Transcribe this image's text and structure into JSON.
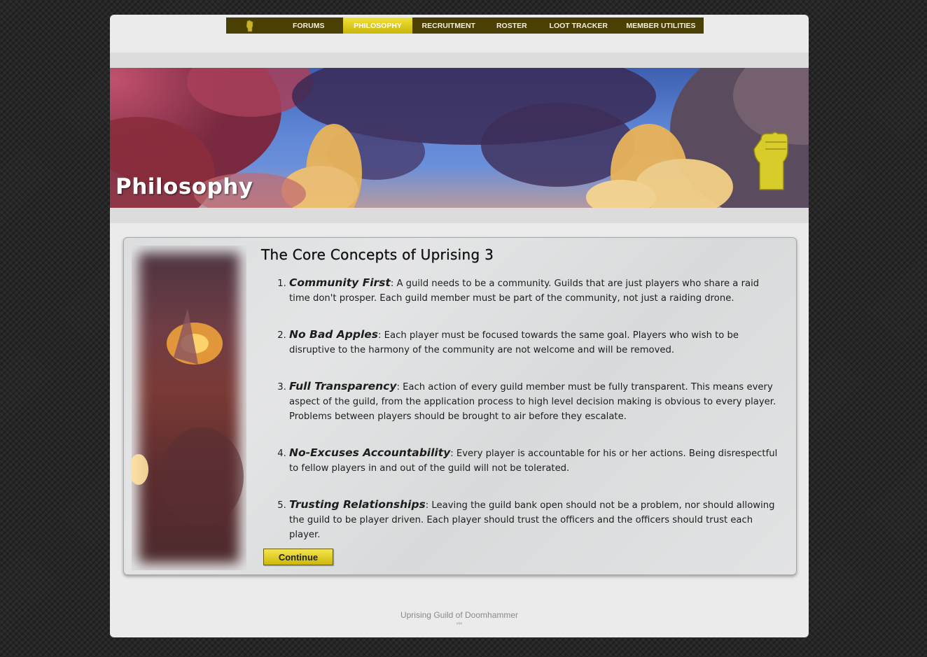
{
  "nav": {
    "logo_icon": "fist-icon",
    "items": [
      {
        "label": "FORUMS",
        "active": false
      },
      {
        "label": "PHILOSOPHY",
        "active": true
      },
      {
        "label": "RECRUITMENT",
        "active": false
      },
      {
        "label": "ROSTER",
        "active": false
      },
      {
        "label": "LOOT TRACKER",
        "active": false
      },
      {
        "label": "MEMBER UTILITIES",
        "active": false
      }
    ]
  },
  "hero": {
    "title": "Philosophy",
    "emblem_icon": "fist-emblem-icon"
  },
  "main": {
    "heading": "The Core Concepts of Uprising 3",
    "concepts": [
      {
        "term": "Community First",
        "text": ": A guild needs to be a community. Guilds that are just players who share a raid time don't prosper. Each guild member must be part of the community, not just a raiding drone."
      },
      {
        "term": "No Bad Apples",
        "text": ": Each player must be focused towards the same goal. Players who wish to be disruptive to the harmony of the community are not welcome and will be removed."
      },
      {
        "term": "Full Transparency",
        "text": ": Each action of every guild member must be fully transparent. This means every aspect of the guild, from the application process to high level decision making is obvious to every player. Problems between players should be brought to air before they escalate."
      },
      {
        "term": "No-Excuses Accountability",
        "text": ": Every player is accountable for his or her actions. Being disrespectful to fellow players in and out of the guild will not be tolerated."
      },
      {
        "term": "Trusting Relationships",
        "text": ": Leaving the guild bank open should not be a problem, nor should allowing the guild to be player driven. Each player should trust the officers and the officers should trust each player."
      }
    ],
    "continue_label": "Continue"
  },
  "footer": {
    "text": "Uprising Guild of Doomhammer",
    "small": "###"
  },
  "colors": {
    "nav_bg": "#4a3f05",
    "accent": "#e5d21f",
    "page_bg": "#ebebeb"
  }
}
